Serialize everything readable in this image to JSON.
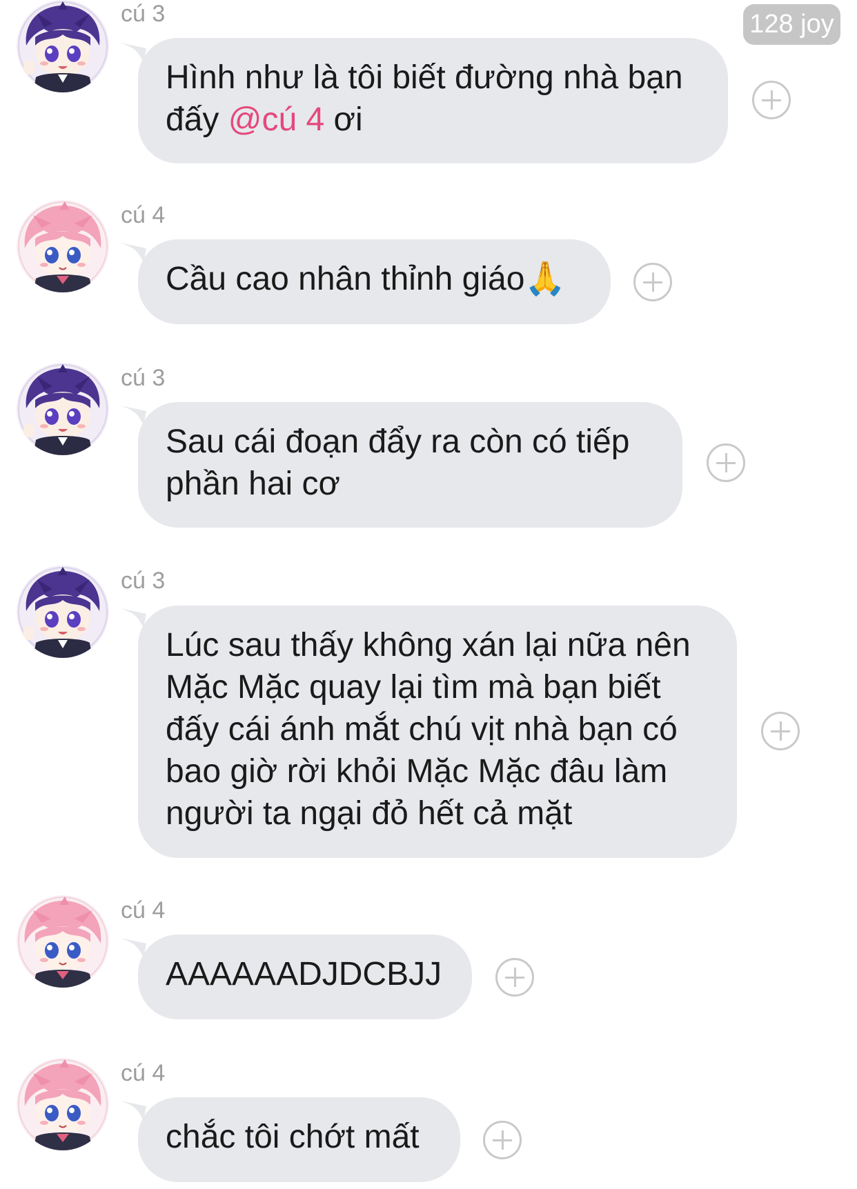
{
  "badge": {
    "text": "128 joy"
  },
  "messages": [
    {
      "sender": "cú 3",
      "avatar": "purple-hair-avatar",
      "text_before": "Hình như là tôi biết đường nhà bạn\nđấy ",
      "mention": "@cú 4",
      "text_after": " ơi"
    },
    {
      "sender": "cú 4",
      "avatar": "pink-hair-avatar",
      "text": "Cầu cao nhân thỉnh giáo🙏"
    },
    {
      "sender": "cú 3",
      "avatar": "purple-hair-avatar",
      "text": "Sau cái đoạn đẩy ra còn có tiếp\nphần hai cơ"
    },
    {
      "sender": "cú 3",
      "avatar": "purple-hair-avatar",
      "text": "Lúc sau thấy không xán lại nữa nên\nMặc Mặc quay lại tìm mà bạn biết\nđấy cái ánh mắt chú vịt nhà bạn có\nbao giờ rời khỏi Mặc Mặc đâu làm\nngười ta ngại đỏ hết cả mặt"
    },
    {
      "sender": "cú 4",
      "avatar": "pink-hair-avatar",
      "text": "AAAAAADJDCBJJ"
    },
    {
      "sender": "cú 4",
      "avatar": "pink-hair-avatar",
      "text": "chắc tôi chớt mất"
    }
  ],
  "icons": {
    "reaction": "add-reaction-icon"
  },
  "colors": {
    "bubble": "#e6e8eb",
    "mention": "#e5487c",
    "sender_name": "#9d9d9d",
    "badge": "#c6c6c6"
  }
}
